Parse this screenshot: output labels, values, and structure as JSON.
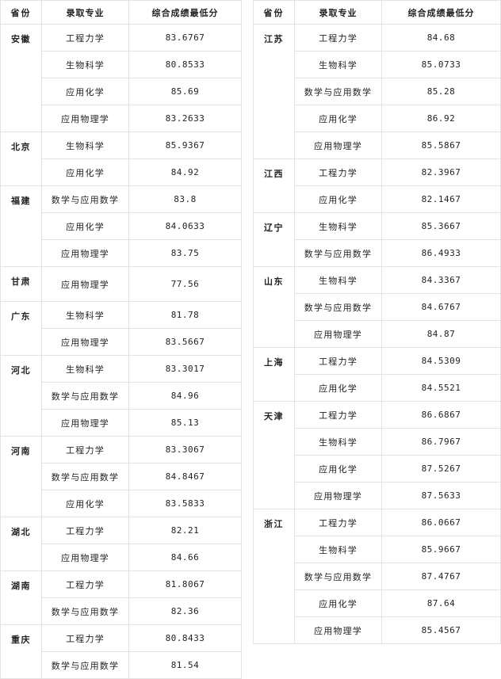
{
  "table": {
    "headers": {
      "province": "省份",
      "major": "录取专业",
      "score": "综合成绩最低分"
    },
    "left_groups": [
      {
        "province": "安徽",
        "rows": [
          {
            "major": "工程力学",
            "score": "83.6767"
          },
          {
            "major": "生物科学",
            "score": "80.8533"
          },
          {
            "major": "应用化学",
            "score": "85.69"
          },
          {
            "major": "应用物理学",
            "score": "83.2633"
          }
        ]
      },
      {
        "province": "北京",
        "rows": [
          {
            "major": "生物科学",
            "score": "85.9367"
          },
          {
            "major": "应用化学",
            "score": "84.92"
          }
        ]
      },
      {
        "province": "福建",
        "rows": [
          {
            "major": "数学与应用数学",
            "score": "83.8"
          },
          {
            "major": "应用化学",
            "score": "84.0633"
          },
          {
            "major": "应用物理学",
            "score": "83.75"
          }
        ]
      },
      {
        "province": "甘肃",
        "rows": [
          {
            "major": "应用物理学",
            "score": "77.56"
          }
        ]
      },
      {
        "province": "广东",
        "rows": [
          {
            "major": "生物科学",
            "score": "81.78"
          },
          {
            "major": "应用物理学",
            "score": "83.5667"
          }
        ]
      },
      {
        "province": "河北",
        "rows": [
          {
            "major": "生物科学",
            "score": "83.3017"
          },
          {
            "major": "数学与应用数学",
            "score": "84.96"
          },
          {
            "major": "应用物理学",
            "score": "85.13"
          }
        ]
      },
      {
        "province": "河南",
        "rows": [
          {
            "major": "工程力学",
            "score": "83.3067"
          },
          {
            "major": "数学与应用数学",
            "score": "84.8467"
          },
          {
            "major": "应用化学",
            "score": "83.5833"
          }
        ]
      },
      {
        "province": "湖北",
        "rows": [
          {
            "major": "工程力学",
            "score": "82.21"
          },
          {
            "major": "应用物理学",
            "score": "84.66"
          }
        ]
      },
      {
        "province": "湖南",
        "rows": [
          {
            "major": "工程力学",
            "score": "81.8067"
          },
          {
            "major": "数学与应用数学",
            "score": "82.36"
          }
        ]
      },
      {
        "province": "重庆",
        "rows": [
          {
            "major": "工程力学",
            "score": "80.8433"
          },
          {
            "major": "数学与应用数学",
            "score": "81.54"
          }
        ]
      }
    ],
    "right_groups": [
      {
        "province": "江苏",
        "rows": [
          {
            "major": "工程力学",
            "score": "84.68"
          },
          {
            "major": "生物科学",
            "score": "85.0733"
          },
          {
            "major": "数学与应用数学",
            "score": "85.28"
          },
          {
            "major": "应用化学",
            "score": "86.92"
          },
          {
            "major": "应用物理学",
            "score": "85.5867"
          }
        ]
      },
      {
        "province": "江西",
        "rows": [
          {
            "major": "工程力学",
            "score": "82.3967"
          },
          {
            "major": "应用化学",
            "score": "82.1467"
          }
        ]
      },
      {
        "province": "辽宁",
        "rows": [
          {
            "major": "生物科学",
            "score": "85.3667"
          },
          {
            "major": "数学与应用数学",
            "score": "86.4933"
          }
        ]
      },
      {
        "province": "山东",
        "rows": [
          {
            "major": "生物科学",
            "score": "84.3367"
          },
          {
            "major": "数学与应用数学",
            "score": "84.6767"
          },
          {
            "major": "应用物理学",
            "score": "84.87"
          }
        ]
      },
      {
        "province": "上海",
        "rows": [
          {
            "major": "工程力学",
            "score": "84.5309"
          },
          {
            "major": "应用化学",
            "score": "84.5521"
          }
        ]
      },
      {
        "province": "天津",
        "rows": [
          {
            "major": "工程力学",
            "score": "86.6867"
          },
          {
            "major": "生物科学",
            "score": "86.7967"
          },
          {
            "major": "应用化学",
            "score": "87.5267"
          },
          {
            "major": "应用物理学",
            "score": "87.5633"
          }
        ]
      },
      {
        "province": "浙江",
        "rows": [
          {
            "major": "工程力学",
            "score": "86.0667"
          },
          {
            "major": "生物科学",
            "score": "85.9667"
          },
          {
            "major": "数学与应用数学",
            "score": "87.4767"
          },
          {
            "major": "应用化学",
            "score": "87.64"
          },
          {
            "major": "应用物理学",
            "score": "85.4567"
          }
        ]
      }
    ]
  },
  "style": {
    "border_color": "#e3e3e3",
    "text_color": "#222222",
    "background": "#ffffff"
  }
}
